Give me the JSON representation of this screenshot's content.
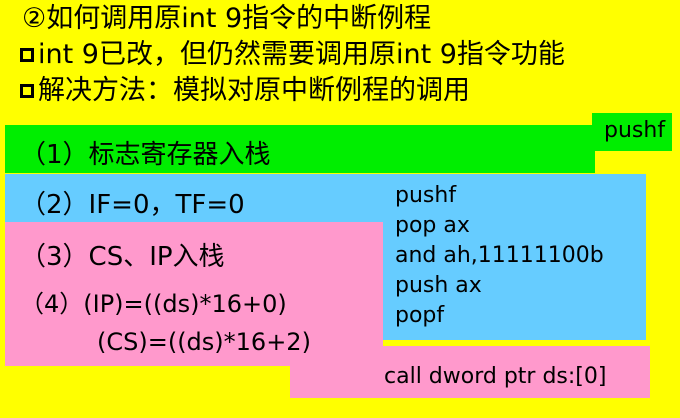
{
  "heading": "②如何调用原int 9指令的中断例程",
  "bullets": [
    "int 9已改，但仍然需要调用原int 9指令功能",
    "解决方法：模拟对原中断例程的调用"
  ],
  "steps": {
    "step1": "（1）标志寄存器入栈",
    "step2": "（2）IF=0，TF=0",
    "step3": "（3）CS、IP入栈",
    "step4": "（4）(IP)=((ds)*16+0)",
    "step4b": "(CS)=((ds)*16+2)"
  },
  "code": {
    "pushf_top": "pushf",
    "block": [
      "pushf",
      "pop ax",
      "and ah,11111100b",
      "push ax",
      "popf"
    ],
    "call": "call dword ptr ds:[0]"
  },
  "colors": {
    "background": "#FFFF00",
    "green": "#00EE00",
    "blue": "#66CCFF",
    "pink": "#FF99CC"
  }
}
